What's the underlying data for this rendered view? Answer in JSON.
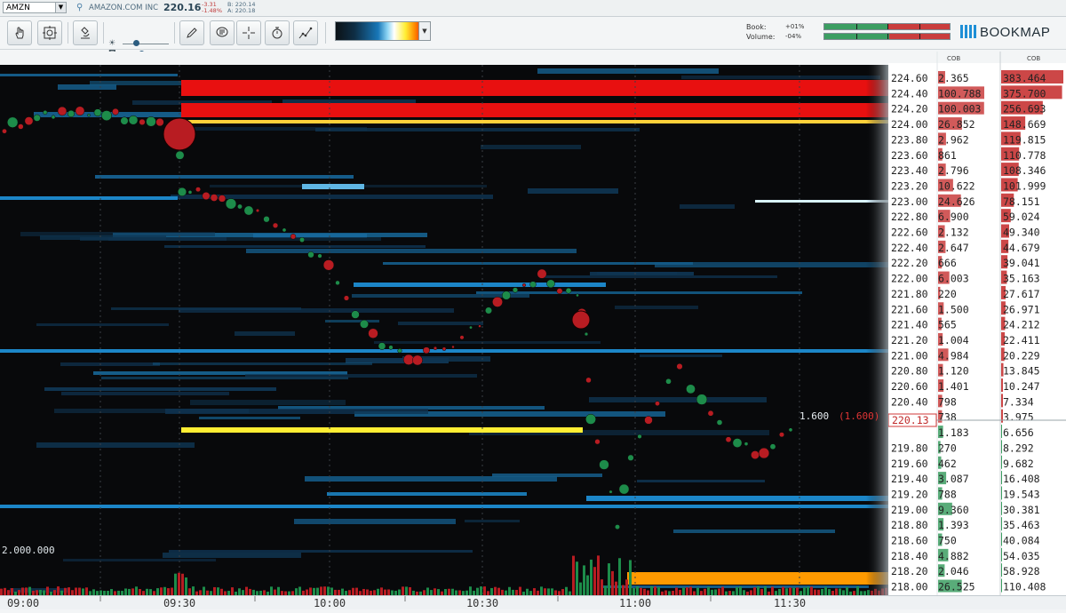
{
  "ticker": {
    "symbol": "AMZN",
    "company": "AMAZON.COM INC",
    "last_price": "220.16",
    "change_abs": "-3.31",
    "change_pct": "-1.48%",
    "bid": "B: 220.14",
    "ask": "A: 220.18"
  },
  "toolbar": {
    "icons": [
      "hand-pointer-icon",
      "target-cursor-icon",
      "microscope-icon",
      "pencil-icon",
      "chat-bubble-icon",
      "crosshair-icon",
      "stopwatch-icon",
      "chart-line-icon"
    ],
    "book_label": "Book:",
    "book_value": "+01%",
    "volume_label": "Volume:",
    "volume_value": "-04%",
    "book_imbalance_green_fraction": 0.51,
    "volume_imbalance_green_fraction": 0.52,
    "logo": "BOOKMAP"
  },
  "colors": {
    "ask": "#c93d3d",
    "bid": "#3c9e62",
    "buy_bubble": "#1d8c4a",
    "sell_bubble": "#b81c22",
    "heatmap_low": "#0d2a40",
    "heatmap_mid": "#1c86c8",
    "heatmap_high": "#ff1a0a"
  },
  "cob": {
    "header_left": "COB",
    "header_right": "COB",
    "rows": [
      {
        "price": "224.60",
        "left": "2.365",
        "right": "383.464"
      },
      {
        "price": "224.40",
        "left": "100.788",
        "right": "375.700"
      },
      {
        "price": "224.20",
        "left": "100.003",
        "right": "256.693"
      },
      {
        "price": "224.00",
        "left": "26.852",
        "right": "148.669"
      },
      {
        "price": "223.80",
        "left": "2.962",
        "right": "119.815"
      },
      {
        "price": "223.60",
        "left": "861",
        "right": "110.778"
      },
      {
        "price": "223.40",
        "left": "2.796",
        "right": "108.346"
      },
      {
        "price": "223.20",
        "left": "10.622",
        "right": "101.999"
      },
      {
        "price": "223.00",
        "left": "24.626",
        "right": "78.151"
      },
      {
        "price": "222.80",
        "left": "6.900",
        "right": "59.024"
      },
      {
        "price": "222.60",
        "left": "2.132",
        "right": "49.340"
      },
      {
        "price": "222.40",
        "left": "2.647",
        "right": "44.679"
      },
      {
        "price": "222.20",
        "left": "666",
        "right": "39.041"
      },
      {
        "price": "222.00",
        "left": "6.003",
        "right": "35.163"
      },
      {
        "price": "221.80",
        "left": "220",
        "right": "27.617"
      },
      {
        "price": "221.60",
        "left": "1.500",
        "right": "26.971"
      },
      {
        "price": "221.40",
        "left": "565",
        "right": "24.212"
      },
      {
        "price": "221.20",
        "left": "1.004",
        "right": "22.411"
      },
      {
        "price": "221.00",
        "left": "4.984",
        "right": "20.229"
      },
      {
        "price": "220.80",
        "left": "1.120",
        "right": "13.845"
      },
      {
        "price": "220.60",
        "left": "1.401",
        "right": "10.247"
      },
      {
        "price": "220.40",
        "left": "798",
        "right": "7.334"
      },
      {
        "price": "",
        "left": "738",
        "right": "3.975"
      },
      {
        "price": "",
        "left": "1.183",
        "right": "6.656"
      },
      {
        "price": "219.80",
        "left": "270",
        "right": "8.292"
      },
      {
        "price": "219.60",
        "left": "462",
        "right": "9.682"
      },
      {
        "price": "219.40",
        "left": "3.087",
        "right": "16.408"
      },
      {
        "price": "219.20",
        "left": "788",
        "right": "19.543"
      },
      {
        "price": "219.00",
        "left": "9.360",
        "right": "30.381"
      },
      {
        "price": "218.80",
        "left": "1.393",
        "right": "35.463"
      },
      {
        "price": "218.60",
        "left": "750",
        "right": "40.084"
      },
      {
        "price": "218.40",
        "left": "4.882",
        "right": "54.035"
      },
      {
        "price": "218.20",
        "left": "2.046",
        "right": "58.928"
      },
      {
        "price": "218.00",
        "left": "26.525",
        "right": "110.408"
      }
    ],
    "current_price_tag": "220.13"
  },
  "chart": {
    "last_trade_size": "1.600",
    "last_trade_aggr": "(1.600)",
    "volume_scale_label": "2.000.000",
    "time_labels": [
      "09:00",
      "09:30",
      "10:00",
      "10:30",
      "11:00",
      "11:30"
    ]
  }
}
